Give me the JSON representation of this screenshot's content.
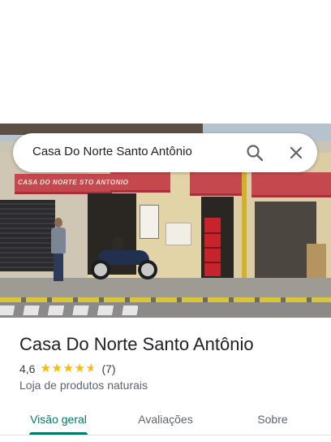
{
  "search": {
    "query": "Casa Do Norte Santo Antônio"
  },
  "photo": {
    "awning_text": "CASA DO NORTE STO ANTONIO"
  },
  "place": {
    "name": "Casa Do Norte Santo Antônio",
    "rating": "4,6",
    "rating_value": 4.6,
    "max_stars": 5,
    "review_count": "(7)",
    "category": "Loja de produtos naturais"
  },
  "tabs": [
    {
      "label": "Visão geral",
      "active": true
    },
    {
      "label": "Avaliações",
      "active": false
    },
    {
      "label": "Sobre",
      "active": false
    }
  ],
  "colors": {
    "accent": "#00796b",
    "star": "#fbbc04",
    "awning": "#c6484f"
  },
  "icons": {
    "search": "search-icon",
    "close": "close-icon",
    "star": "star-icon"
  }
}
